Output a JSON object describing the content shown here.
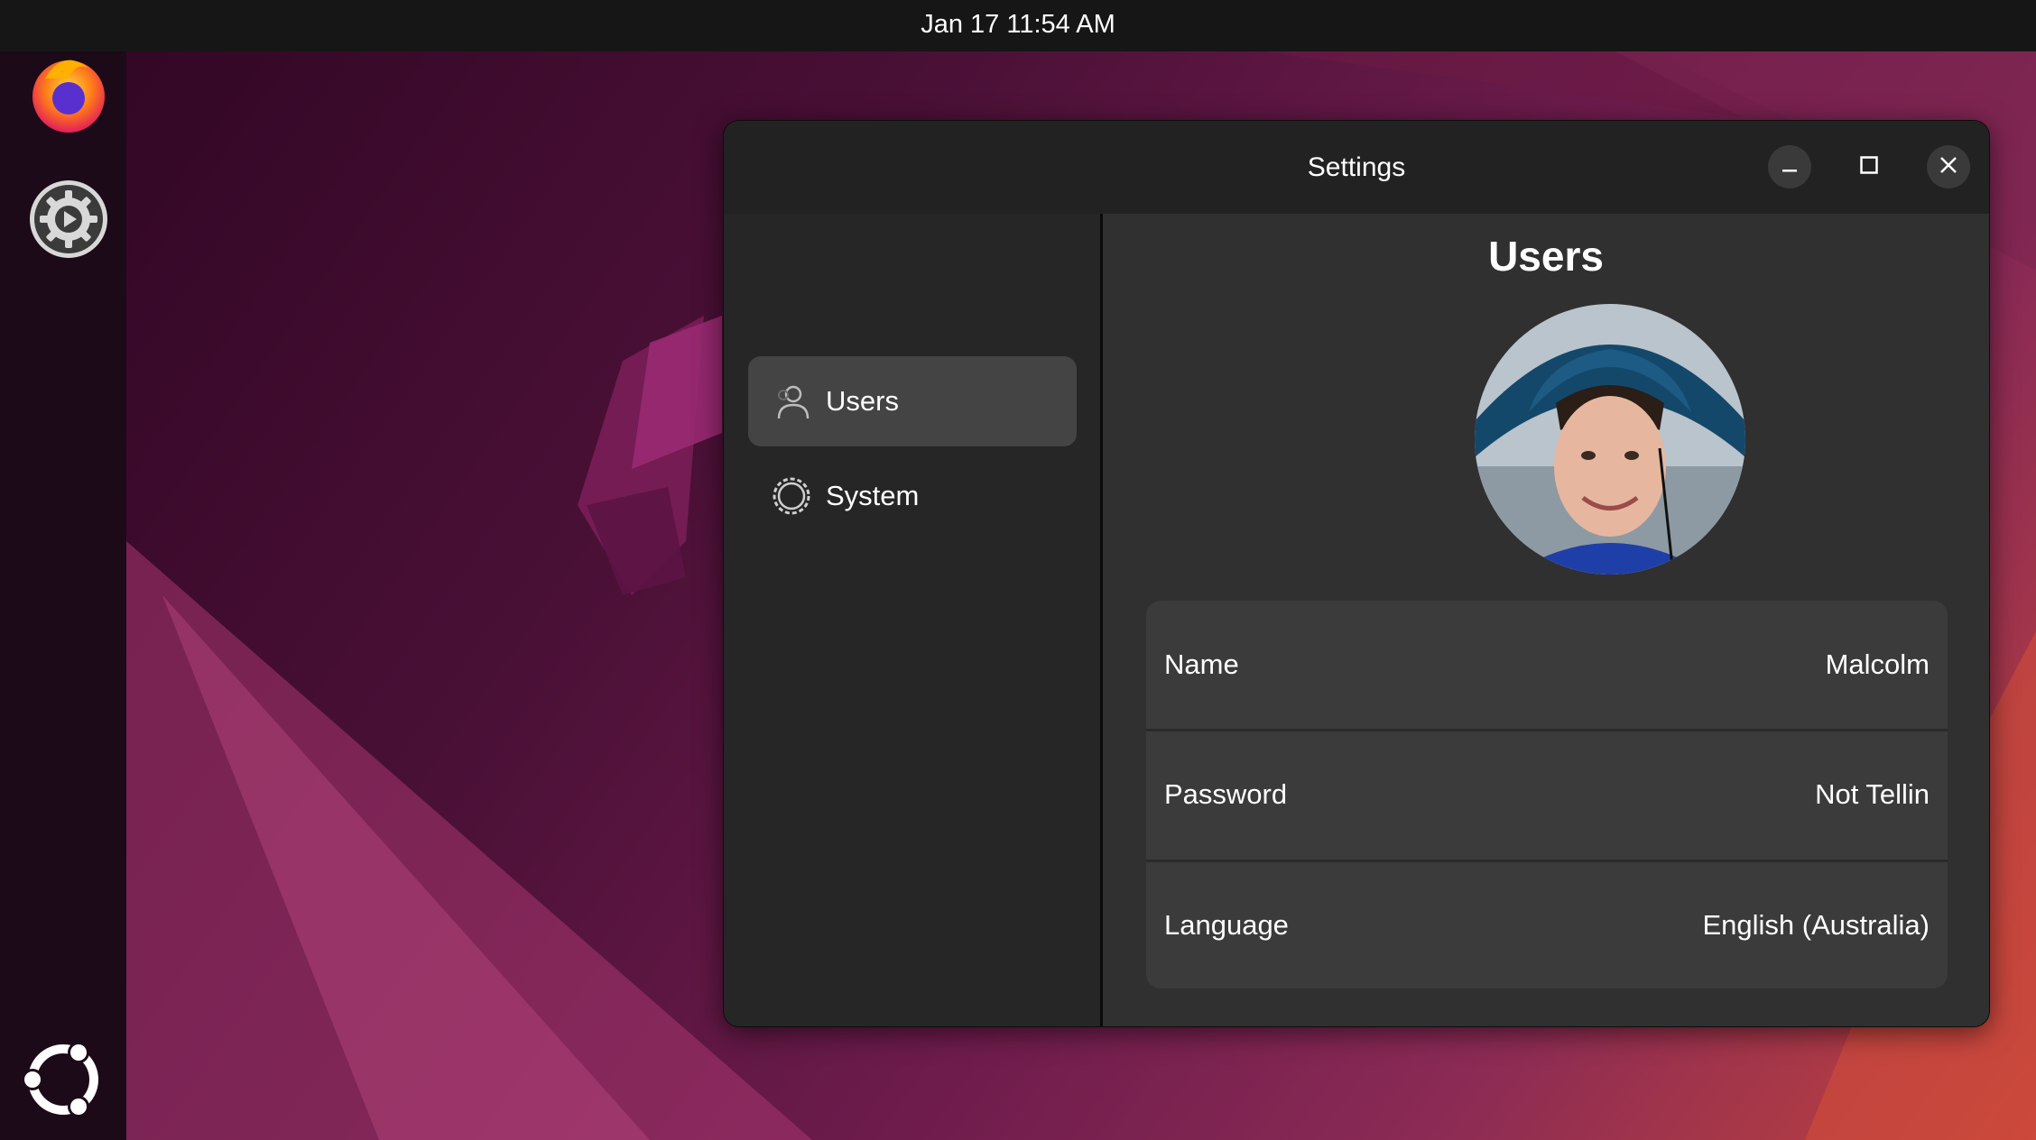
{
  "topbar": {
    "clock": "Jan 17  11:54 AM"
  },
  "dock": {
    "items": [
      {
        "name": "Firefox",
        "icon": "firefox-icon"
      },
      {
        "name": "Settings",
        "icon": "gear-icon"
      },
      {
        "name": "Show Apps",
        "icon": "ubuntu-logo-icon"
      }
    ]
  },
  "window": {
    "title": "Settings",
    "controls": [
      "minimize-icon",
      "maximize-icon",
      "close-icon"
    ]
  },
  "sidebar": {
    "items": [
      {
        "label": "Users",
        "icon": "user-icon",
        "active": true
      },
      {
        "label": "System",
        "icon": "gear-icon",
        "active": false
      }
    ]
  },
  "main": {
    "title": "Users",
    "avatar": "user-photo",
    "rows": [
      {
        "label": "Name",
        "value": "Malcolm"
      },
      {
        "label": "Password",
        "value": "Not Tellin"
      },
      {
        "label": "Language",
        "value": "English (Australia)"
      }
    ]
  },
  "colors": {
    "topbar": "#161616",
    "dock": "#1c0a18",
    "window_bg": "#242424",
    "sidebar_active": "#444444",
    "content_bg": "#303030",
    "list_bg": "#3b3b3b"
  }
}
